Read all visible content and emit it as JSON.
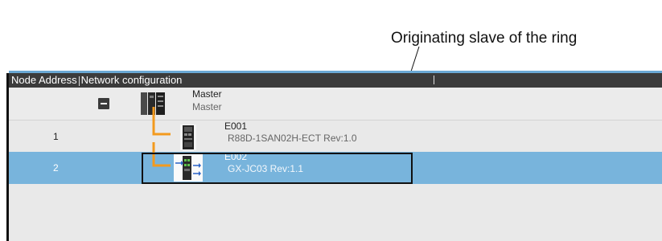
{
  "callout": {
    "text": "Originating slave of the ring"
  },
  "table": {
    "header": {
      "col1": "Node Address",
      "col2": "Network configuration"
    },
    "rows": [
      {
        "address": "",
        "name": "Master",
        "model": "Master",
        "icon": "master-controller-icon",
        "expanded": true
      },
      {
        "address": "1",
        "name": "E001",
        "model": "R88D-1SAN02H-ECT Rev:1.0",
        "icon": "servo-drive-icon"
      },
      {
        "address": "2",
        "name": "E002",
        "model": "GX-JC03 Rev:1.1",
        "icon": "junction-slave-icon",
        "selected": true
      }
    ]
  },
  "colors": {
    "selection": "#78b4dc",
    "connector": "#f39a1e",
    "header": "#3b3b3b"
  }
}
